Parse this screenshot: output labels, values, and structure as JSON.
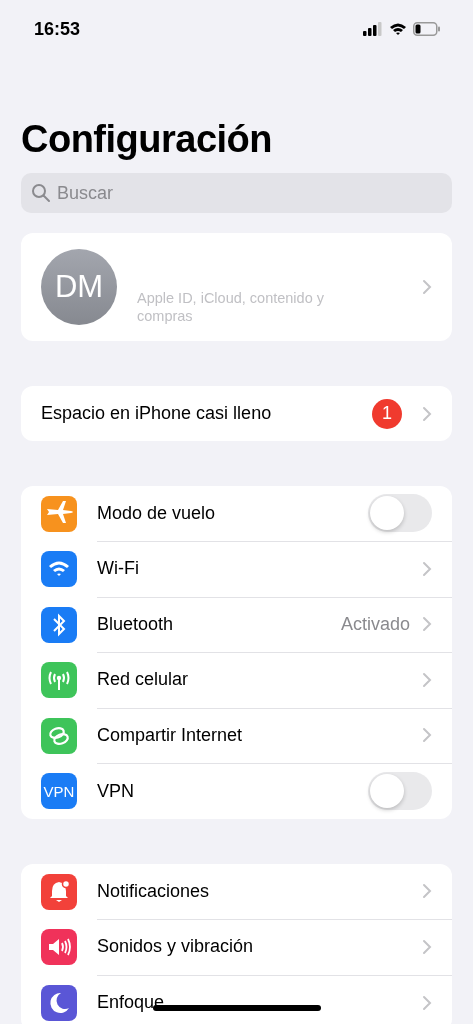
{
  "status_bar": {
    "time": "16:53"
  },
  "title": "Configuración",
  "search": {
    "placeholder": "Buscar"
  },
  "profile": {
    "initials": "DM",
    "subtitle": "Apple ID, iCloud, contenido y compras"
  },
  "alert": {
    "label": "Espacio en iPhone casi lleno",
    "badge": "1"
  },
  "groups": [
    {
      "rows": [
        {
          "label": "Modo de vuelo",
          "kind": "toggle",
          "on": false,
          "color": "#f7921e"
        },
        {
          "label": "Wi-Fi",
          "kind": "link",
          "color": "#1a7cf5"
        },
        {
          "label": "Bluetooth",
          "kind": "link",
          "value": "Activado",
          "color": "#1a7cf5"
        },
        {
          "label": "Red celular",
          "kind": "link",
          "color": "#3ec45a"
        },
        {
          "label": "Compartir Internet",
          "kind": "link",
          "color": "#3ec45a"
        },
        {
          "label": "VPN",
          "kind": "toggle",
          "on": false,
          "color": "#1a7cf5",
          "icon_text": "VPN"
        }
      ]
    },
    {
      "rows": [
        {
          "label": "Notificaciones",
          "kind": "link",
          "color": "#f2413a"
        },
        {
          "label": "Sonidos y vibración",
          "kind": "link",
          "color": "#f0325a"
        },
        {
          "label": "Enfoque",
          "kind": "link",
          "color": "#5a56d6"
        }
      ]
    }
  ]
}
